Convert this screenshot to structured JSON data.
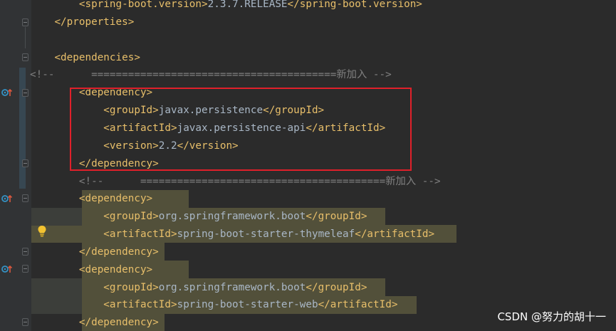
{
  "editor": {
    "language": "xml",
    "lines": [
      {
        "indent": "        ",
        "parts": [
          [
            "tag",
            "<spring-boot.version>"
          ],
          [
            "txt",
            "2.3.7.RELEASE"
          ],
          [
            "tag",
            "</spring-boot.version>"
          ]
        ]
      },
      {
        "indent": "    ",
        "parts": [
          [
            "tag",
            "</properties>"
          ]
        ]
      },
      {
        "indent": "",
        "parts": []
      },
      {
        "indent": "    ",
        "parts": [
          [
            "tag",
            "<dependencies>"
          ]
        ]
      },
      {
        "indent": "",
        "parts": [
          [
            "cmt",
            "<!--      ========================================新加入 -->"
          ]
        ]
      },
      {
        "indent": "        ",
        "parts": [
          [
            "tag",
            "<dependency>"
          ]
        ]
      },
      {
        "indent": "            ",
        "parts": [
          [
            "tag",
            "<groupId>"
          ],
          [
            "txt",
            "javax.persistence"
          ],
          [
            "tag",
            "</groupId>"
          ]
        ]
      },
      {
        "indent": "            ",
        "parts": [
          [
            "tag",
            "<artifactId>"
          ],
          [
            "txt",
            "javax.persistence-api"
          ],
          [
            "tag",
            "</artifactId>"
          ]
        ]
      },
      {
        "indent": "            ",
        "parts": [
          [
            "tag",
            "<version>"
          ],
          [
            "txt",
            "2.2"
          ],
          [
            "tag",
            "</version>"
          ]
        ]
      },
      {
        "indent": "        ",
        "parts": [
          [
            "tag",
            "</dependency>"
          ]
        ]
      },
      {
        "indent": "        ",
        "parts": [
          [
            "cmt",
            "<!--      ========================================新加入 -->"
          ]
        ]
      },
      {
        "indent": "        ",
        "parts": [
          [
            "tag",
            "<dependency>"
          ]
        ]
      },
      {
        "indent": "            ",
        "parts": [
          [
            "tag",
            "<groupId>"
          ],
          [
            "txt",
            "org.springframework.boot"
          ],
          [
            "tag",
            "</groupId>"
          ]
        ]
      },
      {
        "indent": "            ",
        "parts": [
          [
            "tag",
            "<artifactId>"
          ],
          [
            "txt",
            "spring-boot-starter-thymeleaf"
          ],
          [
            "tag",
            "</artifactId>"
          ]
        ]
      },
      {
        "indent": "        ",
        "parts": [
          [
            "tag",
            "</dependency>"
          ]
        ]
      },
      {
        "indent": "        ",
        "parts": [
          [
            "tag",
            "<dependency>"
          ]
        ]
      },
      {
        "indent": "            ",
        "parts": [
          [
            "tag",
            "<groupId>"
          ],
          [
            "txt",
            "org.springframework.boot"
          ],
          [
            "tag",
            "</groupId>"
          ]
        ]
      },
      {
        "indent": "            ",
        "parts": [
          [
            "tag",
            "<artifactId>"
          ],
          [
            "txt",
            "spring-boot-starter-web"
          ],
          [
            "tag",
            "</artifactId>"
          ]
        ]
      },
      {
        "indent": "        ",
        "parts": [
          [
            "tag",
            "</dependency>"
          ]
        ]
      }
    ],
    "highlighted_lines": [
      11,
      12,
      13,
      14,
      15,
      16,
      17,
      18
    ],
    "boxed_lines": [
      5,
      6,
      7,
      8,
      9
    ],
    "gutter_icons": [
      {
        "line": 5,
        "icon": "implemented-marker-icon"
      },
      {
        "line": 11,
        "icon": "implemented-marker-icon"
      },
      {
        "line": 15,
        "icon": "implemented-marker-icon"
      },
      {
        "line": 13,
        "icon": "lightbulb-icon"
      }
    ]
  },
  "watermark": {
    "text": "CSDN @努力的胡十一"
  },
  "colors": {
    "background": "#2b2b2b",
    "tag": "#e8bf6a",
    "text": "#a9b7c6",
    "comment": "#808080",
    "highlight": "#52503a",
    "box": "#e0202a"
  }
}
